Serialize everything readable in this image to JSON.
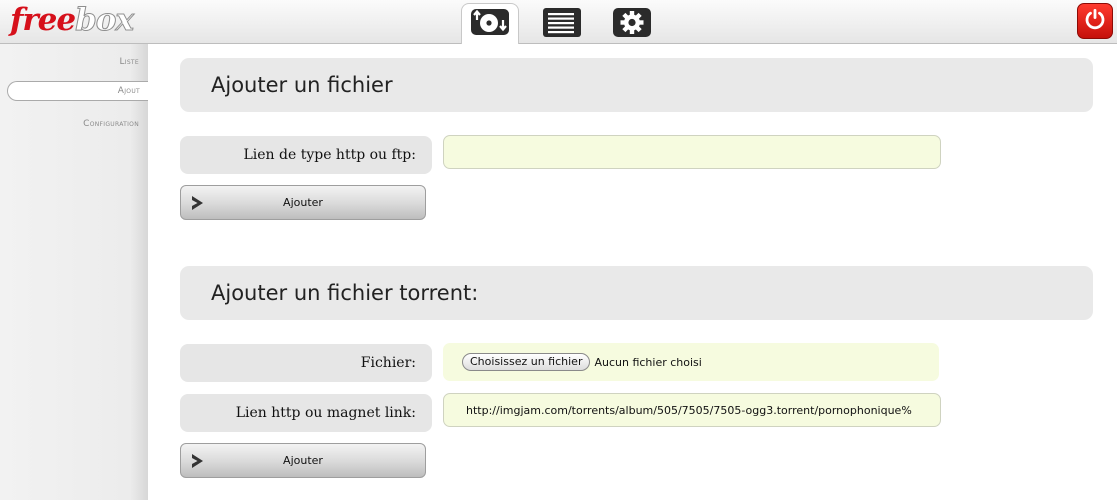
{
  "header": {
    "logo_free": "free",
    "logo_box": "box",
    "tabs": [
      {
        "icon": "download-manager-icon",
        "active": true
      },
      {
        "icon": "list-icon",
        "active": false
      },
      {
        "icon": "gear-icon",
        "active": false
      }
    ],
    "power_icon": "power-icon"
  },
  "sidebar": {
    "items": [
      {
        "label": "Liste",
        "active": false
      },
      {
        "label": "Ajout",
        "active": true
      },
      {
        "label": "Configuration",
        "active": false
      }
    ]
  },
  "main": {
    "http_section": {
      "title": "Ajouter un fichier",
      "link_label": "Lien de type http ou ftp:",
      "link_value": "",
      "submit_label": "Ajouter"
    },
    "torrent_section": {
      "title": "Ajouter un fichier torrent:",
      "file_label": "Fichier:",
      "file_button": "Choisissez un fichier",
      "file_status": "Aucun fichier choisi",
      "link_label": "Lien http ou magnet link:",
      "link_value": "http://imgjam.com/torrents/album/505/7505/7505-ogg3.torrent/pornophonique%",
      "submit_label": "Ajouter"
    }
  },
  "colors": {
    "brand_red": "#d6101b",
    "input_background": "#f6fbdf",
    "section_background": "#e9e9e9",
    "power_button": "#e0201a"
  }
}
